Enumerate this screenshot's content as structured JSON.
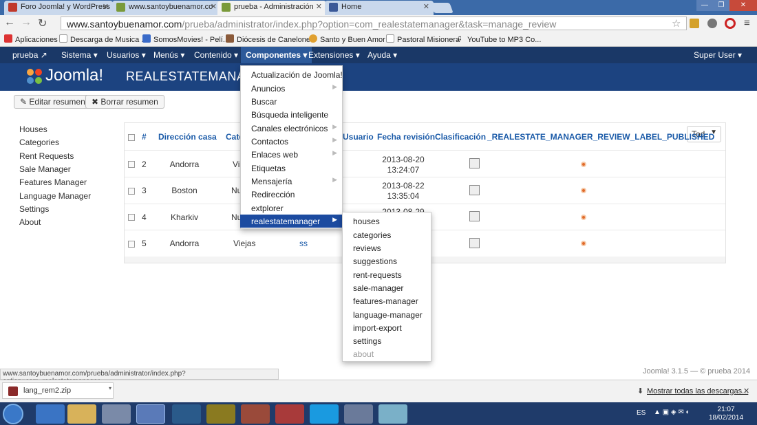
{
  "browser": {
    "tabs": [
      {
        "title": "Foro Joomla! y WordPress"
      },
      {
        "title": "www.santoybuenamor.co"
      },
      {
        "title": "prueba - Administración"
      },
      {
        "title": "Home"
      }
    ],
    "url_host": "www.santoybuenamor.com",
    "url_path": "/prueba/administrator/index.php?option=com_realestatemanager&task=manage_review",
    "bookmarks": [
      "Aplicaciones",
      "Descarga de Musica ...",
      "SomosMovies! - Pelí...",
      "Diócesis de Canelones",
      "Santo y Buen Amor",
      "Pastoral Misionera",
      "YouTube to MP3 Co..."
    ],
    "status_url": "www.santoybuenamor.com/prueba/administrator/index.php?option=com_realestatemanager",
    "download_file": "lang_rem2.zip",
    "show_all_downloads": "Mostrar todas las descargas..."
  },
  "topnav": {
    "site": "prueba",
    "items": [
      "Sistema",
      "Usuarios",
      "Menús",
      "Contenido",
      "Componentes",
      "Extensiones",
      "Ayuda"
    ],
    "user": "Super User"
  },
  "header": {
    "logo": "Joomla!",
    "page_title": "REALESTATEMANAGER"
  },
  "toolbar": {
    "edit": "Editar resumen",
    "delete": "Borrar resumen"
  },
  "sidebar": [
    "Houses",
    "Categories",
    "Rent Requests",
    "Sale Manager",
    "Features Manager",
    "Language Manager",
    "Settings",
    "About"
  ],
  "table": {
    "headers": [
      "#",
      "Dirección casa",
      "Cate",
      "Usuario",
      "Fecha revisión",
      "Clasificación",
      "_REALESTATE_MANAGER_REVIEW_LABEL_PUBLISHED"
    ],
    "rows": [
      {
        "id": "2",
        "address": "Andorra",
        "cat": "Vi",
        "date1": "2013-08-20",
        "date2": "13:24:07"
      },
      {
        "id": "3",
        "address": "Boston",
        "cat": "Nu",
        "date1": "2013-08-22",
        "date2": "13:35:04"
      },
      {
        "id": "4",
        "address": "Kharkiv",
        "cat": "Nu",
        "date1": "2013-08-29",
        "date2": ""
      },
      {
        "id": "5",
        "address": "Andorra",
        "cat": "Viejas",
        "title": "ss",
        "date1": "",
        "date2": ""
      }
    ],
    "filter": "Tod"
  },
  "components_menu": [
    {
      "label": "Actualización de Joomla!",
      "sub": false
    },
    {
      "label": "Anuncios",
      "sub": true
    },
    {
      "label": "Buscar",
      "sub": false
    },
    {
      "label": "Búsqueda inteligente",
      "sub": false
    },
    {
      "label": "Canales electrónicos",
      "sub": true
    },
    {
      "label": "Contactos",
      "sub": true
    },
    {
      "label": "Enlaces web",
      "sub": true
    },
    {
      "label": "Etiquetas",
      "sub": false
    },
    {
      "label": "Mensajería",
      "sub": true
    },
    {
      "label": "Redirección",
      "sub": false
    },
    {
      "label": "extplorer",
      "sub": false
    },
    {
      "label": "realestatemanager",
      "sub": true
    }
  ],
  "submenu": [
    "houses",
    "categories",
    "reviews",
    "suggestions",
    "rent-requests",
    "sale-manager",
    "features-manager",
    "language-manager",
    "import-export",
    "settings",
    "about"
  ],
  "footer": "Joomla! 3.1.5 — © prueba 2014",
  "taskbar": {
    "lang": "ES",
    "time": "21:07",
    "date": "18/02/2014"
  }
}
